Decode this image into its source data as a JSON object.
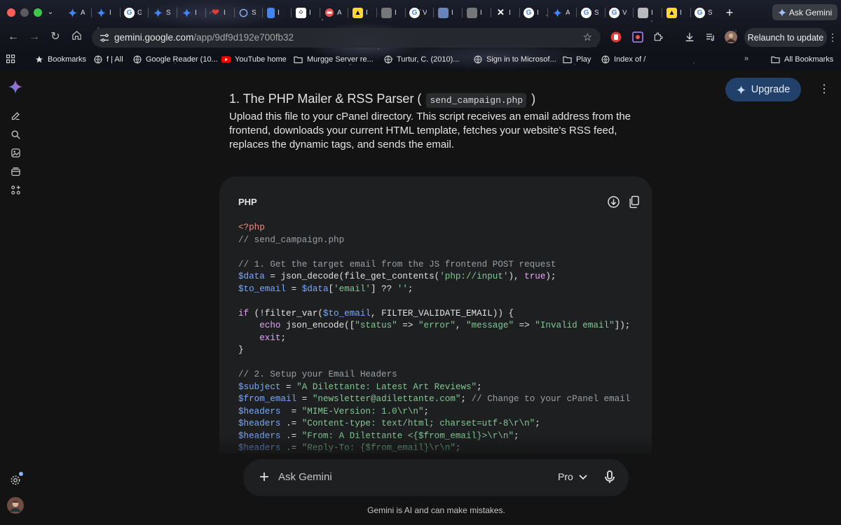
{
  "browser": {
    "tabs": [
      {
        "title": "A",
        "icon": "gemini-icon",
        "color": "#4285f4"
      },
      {
        "title": "I",
        "icon": "gemini-icon",
        "color": "#4285f4"
      },
      {
        "title": "G",
        "icon": "google-icon",
        "color": "#ffffff"
      },
      {
        "title": "S",
        "icon": "gemini-icon",
        "color": "#4285f4"
      },
      {
        "title": "I",
        "icon": "gemini-icon",
        "color": "#4285f4"
      },
      {
        "title": "I",
        "icon": "heart-icon",
        "color": "#e53935"
      },
      {
        "title": "S",
        "icon": "clock-icon",
        "color": "#8ab4f8"
      },
      {
        "title": "I",
        "icon": "docs-icon",
        "color": "#4285f4"
      },
      {
        "title": "I",
        "icon": "dice-icon",
        "color": "#ffffff"
      },
      {
        "title": "A",
        "icon": "circle-icon",
        "color": "#ef5350"
      },
      {
        "title": "I",
        "icon": "yellow-square-icon",
        "color": "#fdd835"
      },
      {
        "title": "I",
        "icon": "speaker-icon",
        "color": "#9e9e9e"
      },
      {
        "title": "V",
        "icon": "google-icon",
        "color": "#ffffff"
      },
      {
        "title": "I",
        "icon": "square-icon",
        "color": "#8ab4f8"
      },
      {
        "title": "I",
        "icon": "image-icon",
        "color": "#9e9e9e"
      },
      {
        "title": "I",
        "icon": "x-icon",
        "color": "#ffffff"
      },
      {
        "title": "I",
        "icon": "google-icon",
        "color": "#ffffff"
      },
      {
        "title": "A",
        "icon": "gemini-icon",
        "color": "#4285f4"
      },
      {
        "title": "S",
        "icon": "google-icon",
        "color": "#ffffff"
      },
      {
        "title": "V",
        "icon": "google-icon",
        "color": "#ffffff"
      },
      {
        "title": "I",
        "icon": "blank-icon",
        "color": "#ffffff"
      },
      {
        "title": "I",
        "icon": "yellow-square-icon",
        "color": "#fdd835"
      },
      {
        "title": "S",
        "icon": "google-icon",
        "color": "#ffffff"
      }
    ],
    "ask_gemini_label": "Ask Gemini",
    "url_host": "gemini.google.com",
    "url_path": "/app/9df9d192e700fb32",
    "relaunch_label": "Relaunch to update",
    "bookmarks": [
      {
        "label": "Bookmarks",
        "icon": "star-icon"
      },
      {
        "label": "f | All",
        "icon": "globe-icon"
      },
      {
        "label": "Google Reader (10...",
        "icon": "globe-icon"
      },
      {
        "label": "YouTube home",
        "icon": "youtube-icon"
      },
      {
        "label": "Murgge Server re...",
        "icon": "folder-icon"
      },
      {
        "label": "Turtur, C. (2010)...",
        "icon": "globe-icon"
      },
      {
        "label": "Sign in to Microsof...",
        "icon": "globe-icon"
      },
      {
        "label": "Play",
        "icon": "folder-icon"
      },
      {
        "label": "Index of /",
        "icon": "globe-icon"
      }
    ],
    "overflow_label": "»",
    "all_bookmarks_label": "All Bookmarks"
  },
  "page": {
    "upgrade_label": "Upgrade",
    "heading_prefix": "1. The PHP Mailer & RSS Parser (",
    "heading_code": "send_campaign.php",
    "heading_suffix": ")",
    "paragraph": "Upload this file to your cPanel directory. This script receives an email address from the frontend, downloads your current HTML template, fetches your website's RSS feed, replaces the dynamic tags, and sends the email.",
    "code_language": "PHP",
    "code_lines": [
      [
        {
          "t": "tag",
          "v": "<?php"
        }
      ],
      [
        {
          "t": "cmt",
          "v": "// send_campaign.php"
        }
      ],
      [],
      [
        {
          "t": "cmt",
          "v": "// 1. Get the target email from the JS frontend POST request"
        }
      ],
      [
        {
          "t": "var",
          "v": "$data"
        },
        {
          "t": "txt",
          "v": " = json_decode(file_get_contents("
        },
        {
          "t": "str",
          "v": "'php://input'"
        },
        {
          "t": "txt",
          "v": "), "
        },
        {
          "t": "kw",
          "v": "true"
        },
        {
          "t": "txt",
          "v": ");"
        }
      ],
      [
        {
          "t": "var",
          "v": "$to_email"
        },
        {
          "t": "txt",
          "v": " = "
        },
        {
          "t": "var",
          "v": "$data"
        },
        {
          "t": "txt",
          "v": "["
        },
        {
          "t": "str",
          "v": "'email'"
        },
        {
          "t": "txt",
          "v": "] ?? "
        },
        {
          "t": "str",
          "v": "''"
        },
        {
          "t": "txt",
          "v": ";"
        }
      ],
      [],
      [
        {
          "t": "kw",
          "v": "if"
        },
        {
          "t": "txt",
          "v": " (!filter_var("
        },
        {
          "t": "var",
          "v": "$to_email"
        },
        {
          "t": "txt",
          "v": ", FILTER_VALIDATE_EMAIL)) {"
        }
      ],
      [
        {
          "t": "txt",
          "v": "    "
        },
        {
          "t": "kw",
          "v": "echo"
        },
        {
          "t": "txt",
          "v": " json_encode(["
        },
        {
          "t": "str",
          "v": "\"status\""
        },
        {
          "t": "txt",
          "v": " => "
        },
        {
          "t": "str",
          "v": "\"error\""
        },
        {
          "t": "txt",
          "v": ", "
        },
        {
          "t": "str",
          "v": "\"message\""
        },
        {
          "t": "txt",
          "v": " => "
        },
        {
          "t": "str",
          "v": "\"Invalid email\""
        },
        {
          "t": "txt",
          "v": "]);"
        }
      ],
      [
        {
          "t": "txt",
          "v": "    "
        },
        {
          "t": "kw",
          "v": "exit"
        },
        {
          "t": "txt",
          "v": ";"
        }
      ],
      [
        {
          "t": "txt",
          "v": "}"
        }
      ],
      [],
      [
        {
          "t": "cmt",
          "v": "// 2. Setup your Email Headers"
        }
      ],
      [
        {
          "t": "var",
          "v": "$subject"
        },
        {
          "t": "txt",
          "v": " = "
        },
        {
          "t": "str",
          "v": "\"A Dilettante: Latest Art Reviews\""
        },
        {
          "t": "txt",
          "v": ";"
        }
      ],
      [
        {
          "t": "var",
          "v": "$from_email"
        },
        {
          "t": "txt",
          "v": " = "
        },
        {
          "t": "str",
          "v": "\"newsletter@adilettante.com\""
        },
        {
          "t": "txt",
          "v": "; "
        },
        {
          "t": "cmt",
          "v": "// Change to your cPanel email"
        }
      ],
      [
        {
          "t": "var",
          "v": "$headers"
        },
        {
          "t": "txt",
          "v": "  = "
        },
        {
          "t": "str",
          "v": "\"MIME-Version: 1.0\\r\\n\""
        },
        {
          "t": "txt",
          "v": ";"
        }
      ],
      [
        {
          "t": "var",
          "v": "$headers"
        },
        {
          "t": "txt",
          "v": " .= "
        },
        {
          "t": "str",
          "v": "\"Content-type: text/html; charset=utf-8\\r\\n\""
        },
        {
          "t": "txt",
          "v": ";"
        }
      ],
      [
        {
          "t": "var",
          "v": "$headers"
        },
        {
          "t": "txt",
          "v": " .= "
        },
        {
          "t": "str",
          "v": "\"From: A Dilettante <{$from_email}>\\r\\n\""
        },
        {
          "t": "txt",
          "v": ";"
        }
      ],
      [
        {
          "t": "var",
          "v": "$headers"
        },
        {
          "t": "txt",
          "v": " .= "
        },
        {
          "t": "str",
          "v": "\"Reply-To: {$from_email}\\r\\n\""
        },
        {
          "t": "txt",
          "v": ";"
        }
      ]
    ],
    "composer_placeholder": "Ask Gemini",
    "model_label": "Pro",
    "disclaimer": "Gemini is AI and can make mistakes."
  },
  "colors": {
    "accent": "#4285f4",
    "upgrade_bg": "#21416b",
    "code_bg": "#1e1f20",
    "page_bg": "#131314"
  }
}
